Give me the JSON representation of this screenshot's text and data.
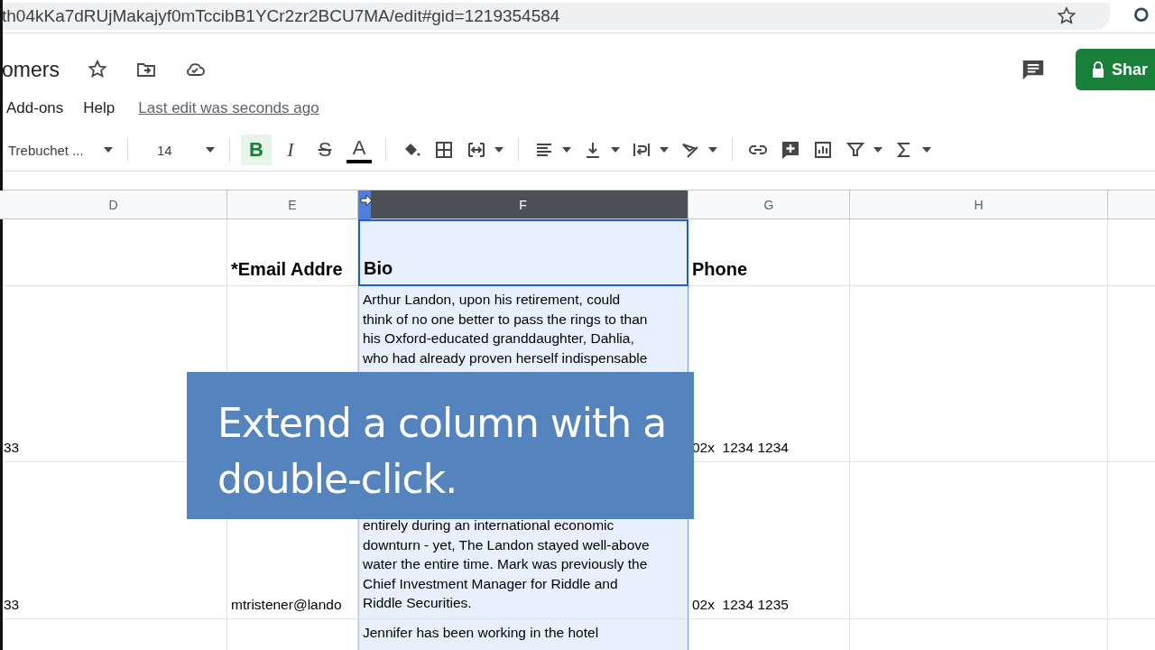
{
  "browser": {
    "url": "th04kKa7dRUjMakajyf0mTccibB1YCr2zr2BCU7MA/edit#gid=1219354584"
  },
  "document": {
    "title": "omers",
    "share_label": "Shar"
  },
  "menu": [
    {
      "label": "Add-ons"
    },
    {
      "label": "Help"
    }
  ],
  "last_edit": "Last edit was seconds ago",
  "toolbar": {
    "font": "Trebuchet ...",
    "font_size": "14",
    "styles": [
      {
        "kind": "bold",
        "label": "B",
        "selected": true
      },
      {
        "kind": "italic",
        "label": "I",
        "selected": false
      },
      {
        "kind": "strike",
        "label": "S",
        "selected": false
      },
      {
        "kind": "color",
        "label": "A",
        "selected": false
      }
    ]
  },
  "columns": [
    {
      "label": "D",
      "selected": false
    },
    {
      "label": "E",
      "selected": false
    },
    {
      "label": "F",
      "selected": true
    },
    {
      "label": "G",
      "selected": false
    },
    {
      "label": "H",
      "selected": false
    }
  ],
  "rows": [
    {
      "kind": "header",
      "e": "*Email Addre",
      "f": [
        "Bio"
      ],
      "g": "Phone"
    },
    {
      "kind": "data",
      "d": "33",
      "f": [
        "Arthur Landon, upon his retirement, could",
        "think of no one better to pass the rings to than",
        "his Oxford-educated granddaughter, Dahlia,",
        "who had already proven herself indispensable"
      ],
      "g": "02x  1234 1234"
    },
    {
      "kind": "data",
      "d": "33",
      "e": "mtristener@lando",
      "f": [
        "entirely during an international economic",
        "downturn - yet, The Landon stayed well-above",
        "water the entire time. Mark was previously the",
        "Chief Investment Manager for Riddle and",
        "Riddle Securities."
      ],
      "g": "02x  1234 1235"
    },
    {
      "kind": "data",
      "f": [
        "Jennifer has been working in the hotel"
      ]
    }
  ],
  "caption": {
    "lines": [
      "Extend a column with a",
      "double-click."
    ]
  }
}
